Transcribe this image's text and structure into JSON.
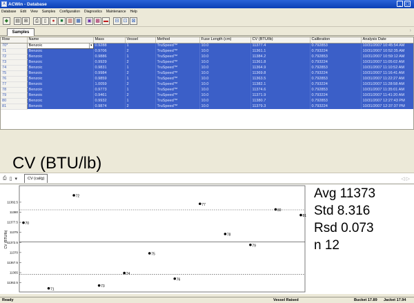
{
  "window": {
    "title": "ACWin - Database",
    "min_glyph": "_",
    "close_glyph": "▢"
  },
  "menu": [
    "Database",
    "Edit",
    "View",
    "Samples",
    "Configuration",
    "Diagnostics",
    "Maintenance",
    "Help"
  ],
  "toolbar_icons": [
    "open-icon",
    "print-icon",
    "tools-icon",
    "printer-icon",
    "preview-icon",
    "color-icon",
    "stop-icon",
    "report-icon",
    "grid-icon",
    "calc-icon",
    "chart-icon",
    "window-icon",
    "export-icon",
    "export2-icon"
  ],
  "tabs": {
    "samples": "Samples"
  },
  "grid": {
    "columns": [
      "Row",
      "Name",
      "Mass",
      "Vessel",
      "Method",
      "Fuse Length (cm)",
      "CV (BTU/lb)",
      "Calibration",
      "Analysis Date"
    ],
    "rows": [
      [
        "70*",
        "Benzoic",
        "0.9288",
        "1",
        "TruSpeed™",
        "10.0",
        "11377.4",
        "0.792853",
        "10/31/2007 10:45:54 AM"
      ],
      [
        "71",
        "Benzoic",
        "0.9706",
        "2",
        "TruSpeed™",
        "10.0",
        "11361.1",
        "0.793224",
        "10/31/2007 10:52:35 AM"
      ],
      [
        "72",
        "Benzoic",
        "0.9886",
        "1",
        "TruSpeed™",
        "10.0",
        "11384.2",
        "0.792853",
        "10/31/2007 10:59:12 AM"
      ],
      [
        "73",
        "Benzoic",
        "0.9929",
        "2",
        "TruSpeed™",
        "10.0",
        "11361.8",
        "0.793224",
        "10/31/2007 11:05:02 AM"
      ],
      [
        "74",
        "Benzoic",
        "0.9831",
        "1",
        "TruSpeed™",
        "10.0",
        "11364.9",
        "0.792853",
        "10/31/2007 11:10:52 AM"
      ],
      [
        "75",
        "Benzoic",
        "0.9984",
        "2",
        "TruSpeed™",
        "10.0",
        "11369.8",
        "0.793224",
        "10/31/2007 11:16:41 AM"
      ],
      [
        "76",
        "Benzoic",
        "0.9859",
        "1",
        "TruSpeed™",
        "10.0",
        "11363.5",
        "0.792853",
        "10/31/2007 11:22:27 AM"
      ],
      [
        "77",
        "Benzoic",
        "1.0059",
        "2",
        "TruSpeed™",
        "10.0",
        "11382.1",
        "0.793224",
        "10/31/2007 11:28:58 AM"
      ],
      [
        "78",
        "Benzoic",
        "0.9773",
        "1",
        "TruSpeed™",
        "10.0",
        "11374.6",
        "0.792853",
        "10/31/2007 11:35:01 AM"
      ],
      [
        "79",
        "Benzoic",
        "0.9461",
        "2",
        "TruSpeed™",
        "10.0",
        "11371.9",
        "0.793224",
        "10/31/2007 11:41:20 AM"
      ],
      [
        "80",
        "Benzoic",
        "0.9932",
        "1",
        "TruSpeed™",
        "10.0",
        "11380.7",
        "0.792853",
        "10/31/2007 12:27:43 PM"
      ],
      [
        "81",
        "Benzoic",
        "0.9874",
        "2",
        "TruSpeed™",
        "10.0",
        "11379.3",
        "0.793224",
        "10/31/2007 12:37:37 PM"
      ]
    ]
  },
  "lower": {
    "tab": "CV (cal/g)"
  },
  "chart_data": {
    "type": "scatter",
    "title": "CV (BTU/lb)",
    "ylabel": "CV (BTU/lb)",
    "ylim": [
      11360.2,
      11386.6
    ],
    "yticks": [
      "11382.5",
      "11380",
      "11377.5",
      "11375",
      "11372.5",
      "11370",
      "11367.5",
      "11365",
      "11362.5"
    ],
    "ytick_values": [
      11382.5,
      11380,
      11377.5,
      11375,
      11372.5,
      11370,
      11367.5,
      11365,
      11362.5
    ],
    "mean": 11372.6,
    "upper_limit": 11380.6,
    "lower_limit": 11364.6,
    "points": [
      {
        "x": 70,
        "y": 11377.4,
        "label": "70"
      },
      {
        "x": 71,
        "y": 11361.1,
        "label": "71"
      },
      {
        "x": 72,
        "y": 11384.2,
        "label": "72"
      },
      {
        "x": 73,
        "y": 11361.8,
        "label": "73"
      },
      {
        "x": 74,
        "y": 11364.9,
        "label": "74"
      },
      {
        "x": 75,
        "y": 11369.8,
        "label": "75"
      },
      {
        "x": 76,
        "y": 11363.5,
        "label": "76"
      },
      {
        "x": 77,
        "y": 11382.1,
        "label": "77"
      },
      {
        "x": 78,
        "y": 11374.6,
        "label": "78"
      },
      {
        "x": 79,
        "y": 11371.9,
        "label": "79"
      },
      {
        "x": 80,
        "y": 11380.7,
        "label": "80"
      },
      {
        "x": 81,
        "y": 11379.3,
        "label": "81"
      }
    ],
    "stats": {
      "avg": "Avg 11373",
      "std": "Std 8.316",
      "rsd": "Rsd 0.073",
      "n": "n 12"
    }
  },
  "status": {
    "state": "Ready",
    "vessel": "Vessel Raised",
    "bucket": "Bucket 17.89",
    "jacket": "Jacket 17.94"
  }
}
